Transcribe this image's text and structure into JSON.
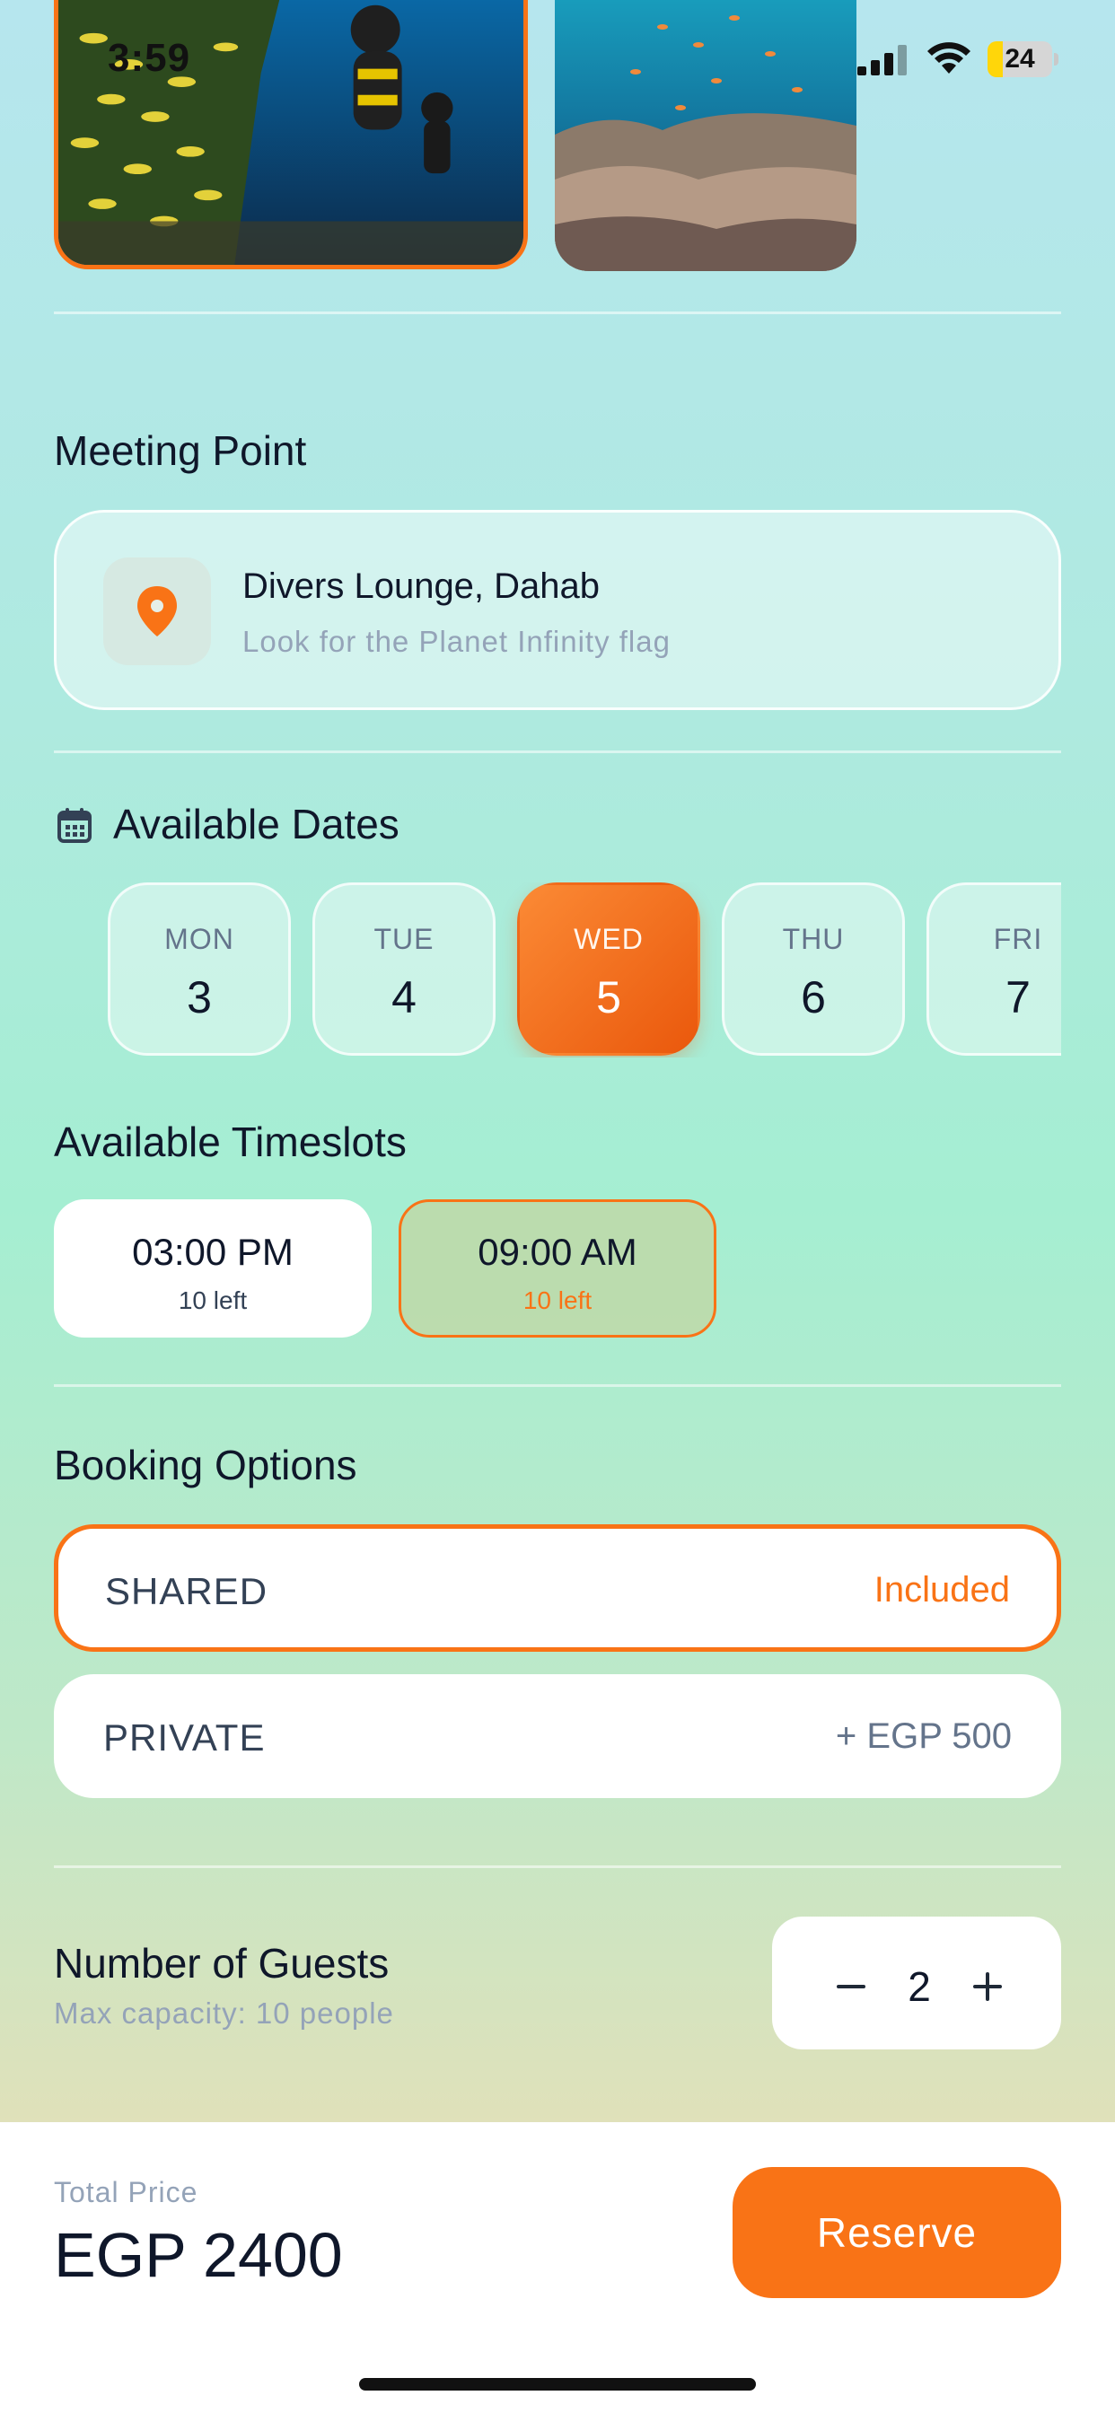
{
  "status_bar": {
    "time": "3:59",
    "battery": "24",
    "battery_level": 0.24
  },
  "gallery": {
    "photos": [
      "diver-photo",
      "coral-reef-photo"
    ]
  },
  "meeting": {
    "title": "Meeting Point",
    "name": "Divers Lounge, Dahab",
    "hint": "Look for the Planet Infinity flag"
  },
  "dates": {
    "title": "Available Dates",
    "items": [
      {
        "day": "MON",
        "num": "3",
        "selected": false
      },
      {
        "day": "TUE",
        "num": "4",
        "selected": false
      },
      {
        "day": "WED",
        "num": "5",
        "selected": true
      },
      {
        "day": "THU",
        "num": "6",
        "selected": false
      },
      {
        "day": "FRI",
        "num": "7",
        "selected": false
      }
    ]
  },
  "timeslots": {
    "title": "Available Timeslots",
    "items": [
      {
        "time": "03:00 PM",
        "left": "10 left",
        "selected": false
      },
      {
        "time": "09:00 AM",
        "left": "10 left",
        "selected": true
      }
    ]
  },
  "booking": {
    "title": "Booking Options",
    "options": [
      {
        "name": "SHARED",
        "price": "Included",
        "selected": true
      },
      {
        "name": "PRIVATE",
        "price": "+ EGP 500",
        "selected": false
      }
    ]
  },
  "guests": {
    "title": "Number of Guests",
    "subtitle": "Max capacity: 10 people",
    "value": "2"
  },
  "footer": {
    "total_label": "Total Price",
    "total_value": "EGP 2400",
    "reserve_label": "Reserve"
  },
  "colors": {
    "accent": "#f97316",
    "accent_dark": "#ea580c",
    "text": "#0f172a",
    "muted": "#94a3b8"
  }
}
